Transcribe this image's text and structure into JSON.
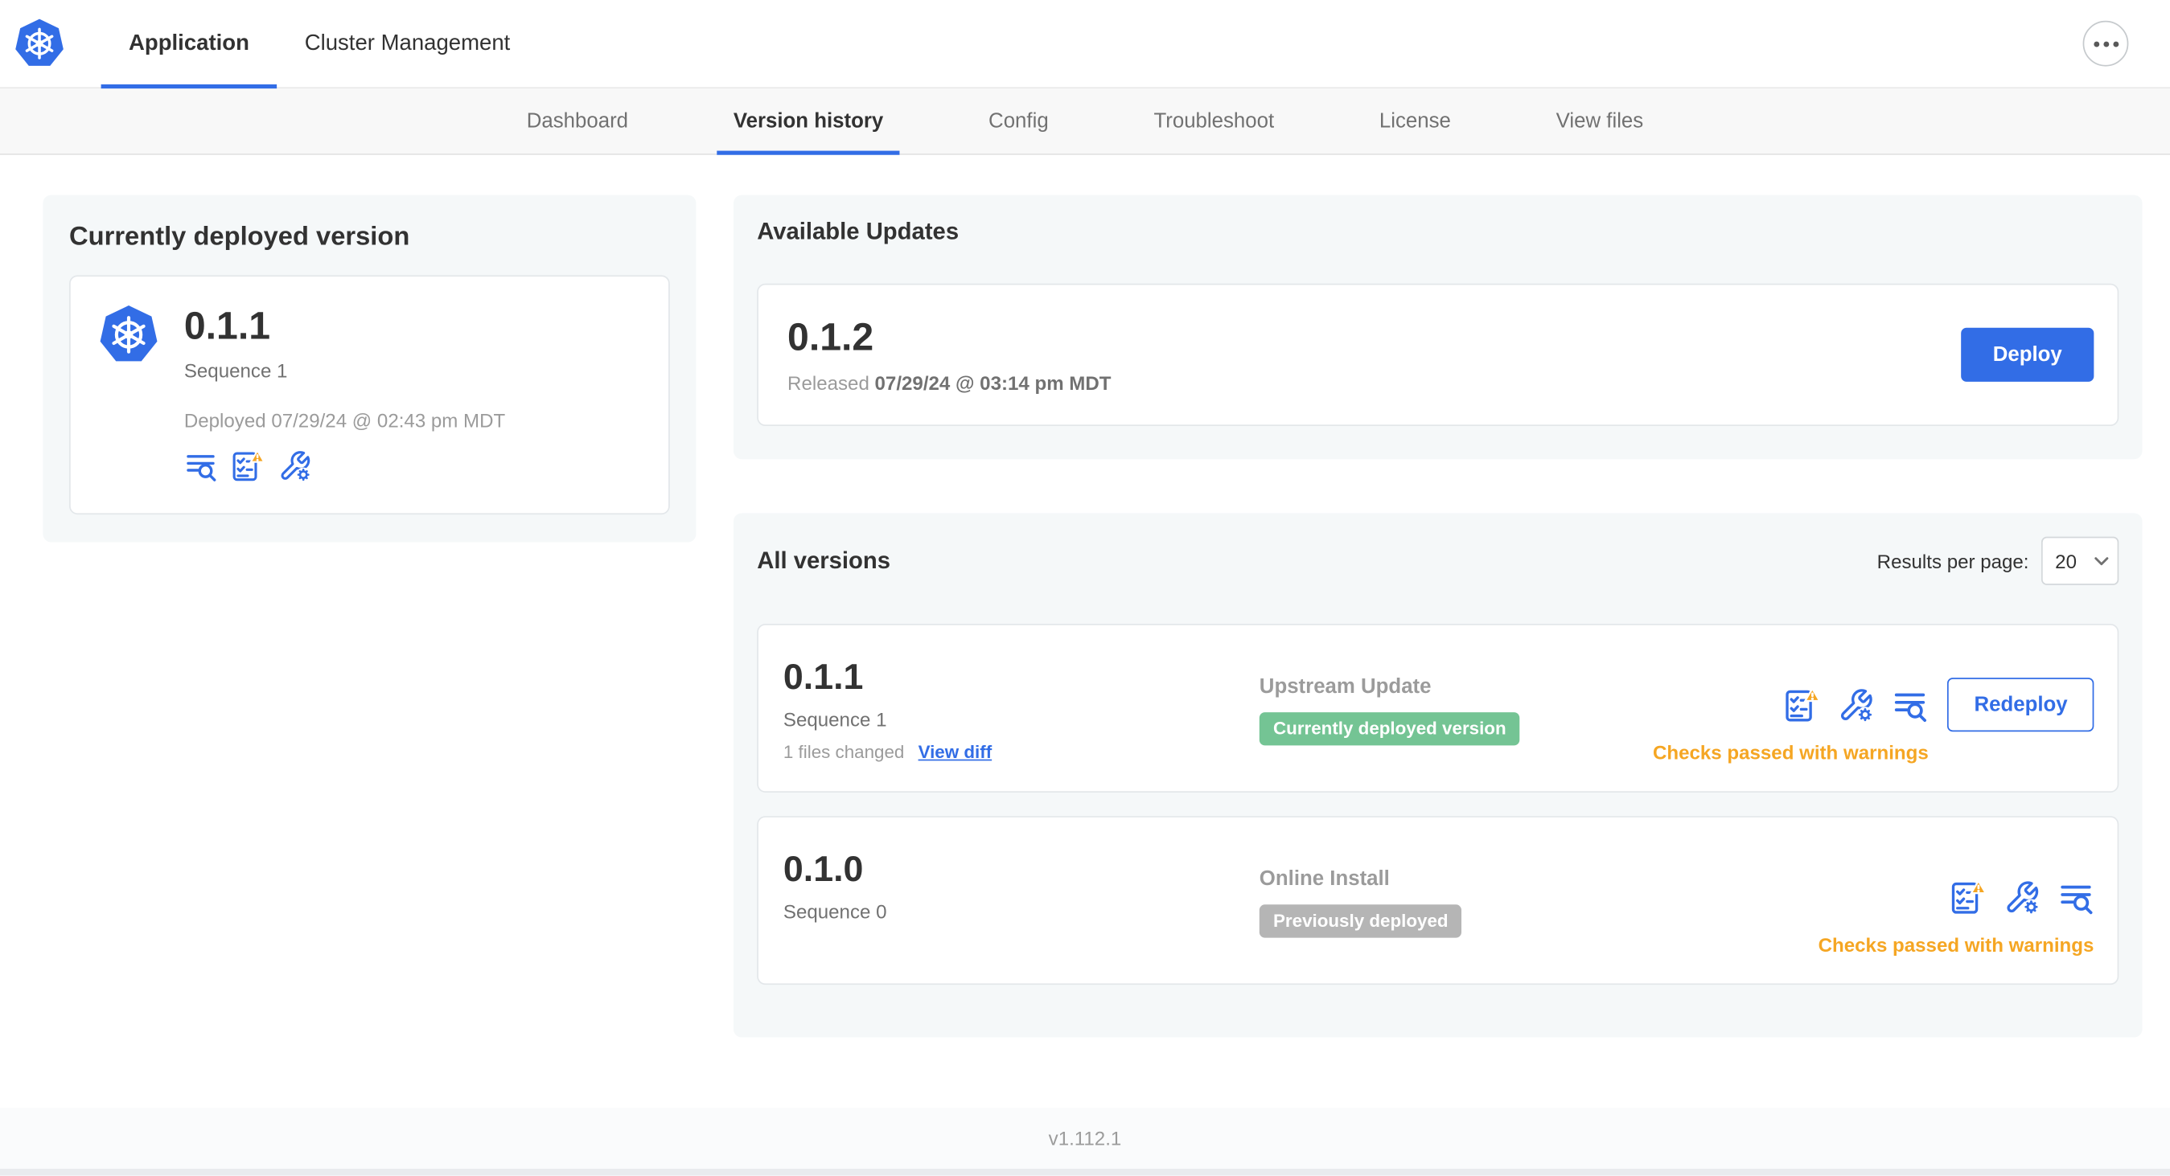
{
  "colors": {
    "accent": "#326de6",
    "warning": "#f5a623",
    "success": "#74c494",
    "neutral": "#b5b5b5"
  },
  "header": {
    "app_tab": "Application",
    "cluster_tab": "Cluster Management"
  },
  "subnav": [
    "Dashboard",
    "Version history",
    "Config",
    "Troubleshoot",
    "License",
    "View files"
  ],
  "current_version": {
    "title": "Currently deployed version",
    "version": "0.1.1",
    "sequence": "Sequence 1",
    "deployed": "Deployed 07/29/24 @ 02:43 pm MDT"
  },
  "available_updates": {
    "title": "Available Updates",
    "version": "0.1.2",
    "released_label": "Released",
    "released_date": "07/29/24 @ 03:14 pm MDT",
    "deploy_button": "Deploy"
  },
  "all_versions": {
    "title": "All versions",
    "results_per_page_label": "Results per page:",
    "results_per_page": "20",
    "rows": [
      {
        "version": "0.1.1",
        "sequence": "Sequence 1",
        "files_changed": "1 files changed",
        "view_diff_link": "View diff",
        "source": "Upstream Update",
        "status_badge": "Currently deployed version",
        "check_status": "Checks passed with warnings",
        "action_button": "Redeploy"
      },
      {
        "version": "0.1.0",
        "sequence": "Sequence 0",
        "source": "Online Install",
        "status_badge": "Previously deployed",
        "check_status": "Checks passed with warnings"
      }
    ]
  },
  "footer": {
    "version": "v1.112.1"
  }
}
